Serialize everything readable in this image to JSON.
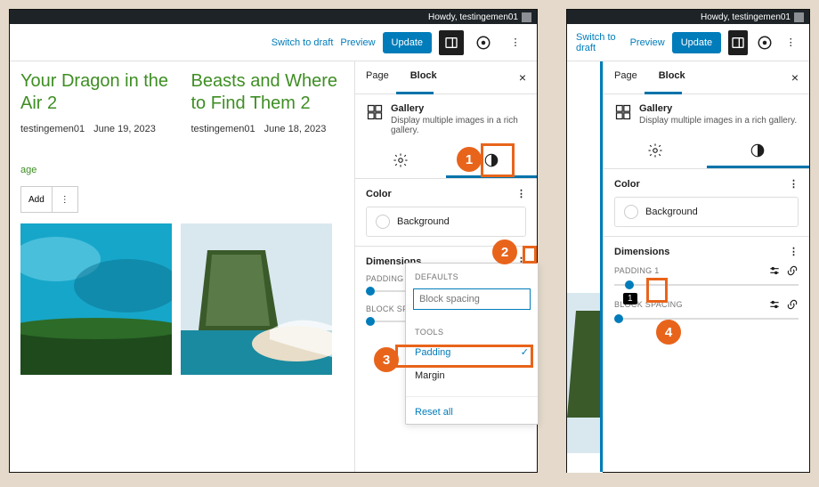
{
  "greeting": "Howdy, testingemen01",
  "toolbar": {
    "switch": "Switch to draft",
    "preview": "Preview",
    "update": "Update"
  },
  "tabs": {
    "page": "Page",
    "block": "Block"
  },
  "block": {
    "name": "Gallery",
    "desc": "Display multiple images in a rich gallery."
  },
  "color": {
    "title": "Color",
    "background": "Background"
  },
  "dimensions": {
    "title": "Dimensions",
    "padding": "PADDING",
    "padding1": "PADDING 1",
    "block_spacing": "BLOCK SPACING",
    "tooltip_val": "1"
  },
  "popover": {
    "defaults": "DEFAULTS",
    "block_spacing_input": "Block spacing",
    "tools": "TOOLS",
    "padding": "Padding",
    "margin": "Margin",
    "reset": "Reset all"
  },
  "posts": [
    {
      "title": "Your Dragon in the Air 2",
      "author": "testingemen01",
      "date": "June 19, 2023"
    },
    {
      "title": "Beasts and Where to Find Them 2",
      "author": "testingemen01",
      "date": "June 18, 2023"
    }
  ],
  "page_link": "age",
  "add": "Add",
  "callouts": {
    "c1": "1",
    "c2": "2",
    "c3": "3",
    "c4": "4"
  }
}
